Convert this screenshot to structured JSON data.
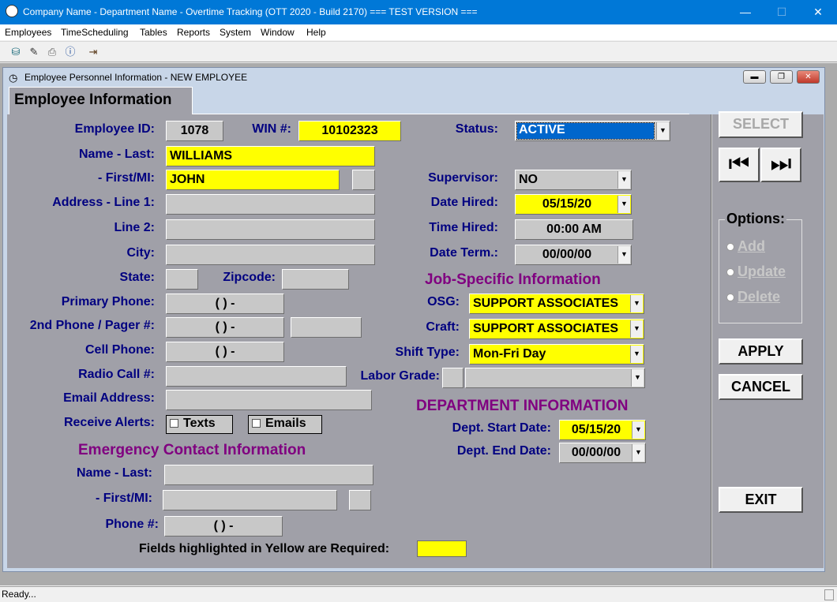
{
  "window": {
    "title": "Company Name - Department Name - Overtime Tracking (OTT 2020 - Build 2170) === TEST VERSION ===",
    "minimize": "—",
    "maximize": "☐",
    "close": "✕"
  },
  "menu": [
    "Employees",
    "TimeScheduling",
    "Tables",
    "Reports",
    "System",
    "Window",
    "Help"
  ],
  "child": {
    "title": "Employee Personnel Information - NEW EMPLOYEE",
    "tab": "Employee Information"
  },
  "labels": {
    "employee_id": "Employee ID:",
    "win": "WIN #:",
    "status": "Status:",
    "name_last": "Name - Last:",
    "first_mi": "- First/MI:",
    "address1": "Address - Line 1:",
    "line2": "Line 2:",
    "city": "City:",
    "state": "State:",
    "zipcode": "Zipcode:",
    "primary_phone": "Primary Phone:",
    "second_phone": "2nd Phone / Pager #:",
    "cell_phone": "Cell Phone:",
    "radio_call": "Radio Call #:",
    "email": "Email Address:",
    "receive_alerts": "Receive Alerts:",
    "supervisor": "Supervisor:",
    "date_hired": "Date Hired:",
    "time_hired": "Time Hired:",
    "date_term": "Date Term.:",
    "osg": "OSG:",
    "craft": "Craft:",
    "shift_type": "Shift Type:",
    "labor_grade": "Labor Grade:",
    "dept_start": "Dept. Start Date:",
    "dept_end": "Dept. End Date:",
    "ec_name_last": "Name - Last:",
    "ec_first_mi": "- First/MI:",
    "ec_phone": "Phone #:",
    "required_note": "Fields highlighted in Yellow are Required:"
  },
  "sections": {
    "job": "Job-Specific  Information",
    "dept": "DEPARTMENT INFORMATION",
    "emergency": "Emergency Contact Information"
  },
  "values": {
    "employee_id": "1078",
    "win": "10102323",
    "status": "ACTIVE",
    "name_last": "WILLIAMS",
    "first": "JOHN",
    "mi": "",
    "phone_mask": "(   )    -",
    "supervisor": "NO",
    "date_hired": "05/15/20",
    "time_hired": "00:00 AM",
    "date_term": "00/00/00",
    "osg": "SUPPORT ASSOCIATES",
    "craft": "SUPPORT ASSOCIATES",
    "shift_type": "Mon-Fri Day",
    "dept_start": "05/15/20",
    "dept_end": "00/00/00"
  },
  "alerts": {
    "texts": "Texts",
    "emails": "Emails"
  },
  "buttons": {
    "select": "SELECT",
    "apply": "APPLY",
    "cancel": "CANCEL",
    "exit": "EXIT"
  },
  "options": {
    "legend": "Options:",
    "add": "Add",
    "update": "Update",
    "delete": "Delete"
  },
  "statusbar": "Ready..."
}
